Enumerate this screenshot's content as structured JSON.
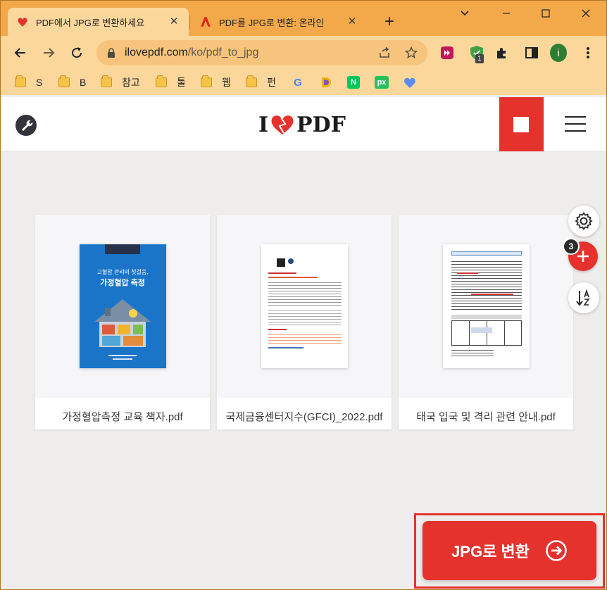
{
  "browser": {
    "tabs": [
      {
        "title": "PDF에서 JPG로 변환하세요",
        "active": true,
        "favicon": "ilovepdf-heart-icon"
      },
      {
        "title": "PDF를 JPG로 변환: 온라인",
        "active": false,
        "favicon": "adobe-acrobat-icon"
      }
    ],
    "address": {
      "host": "ilovepdf.com",
      "path": "/ko/pdf_to_jpg"
    },
    "extension_badge": "1",
    "profile_initial": "i",
    "bookmarks": [
      {
        "label": "S",
        "icon": "folder-icon"
      },
      {
        "label": "B",
        "icon": "folder-icon"
      },
      {
        "label": "참고",
        "icon": "folder-icon"
      },
      {
        "label": "툴",
        "icon": "folder-icon"
      },
      {
        "label": "웹",
        "icon": "folder-icon"
      },
      {
        "label": "펀",
        "icon": "folder-icon"
      },
      {
        "label": "",
        "icon": "google-icon"
      },
      {
        "label": "",
        "icon": "d-icon"
      },
      {
        "label": "",
        "icon": "naver-icon"
      },
      {
        "label": "",
        "icon": "pixlr-icon"
      },
      {
        "label": "",
        "icon": "heart-bookmark-icon"
      }
    ],
    "bookmark_glyphs": {
      "google": "G",
      "naver": "N",
      "pixlr": "px"
    }
  },
  "site": {
    "logo": {
      "left": "I",
      "right": "PDF"
    },
    "brand_color": "#e5322d"
  },
  "files": [
    {
      "name": "가정혈압측정 교육 책자.pdf",
      "cover_line1": "고혈압 관리의 첫걸음,",
      "cover_line2": "가정혈압 측정"
    },
    {
      "name": "국제금융센터지수(GFCI)_2022.pdf"
    },
    {
      "name": "태국 입국 및 격리 관련 안내.pdf"
    }
  ],
  "side_controls": {
    "file_count": "3"
  },
  "convert_button": {
    "label": "JPG로 변환"
  }
}
